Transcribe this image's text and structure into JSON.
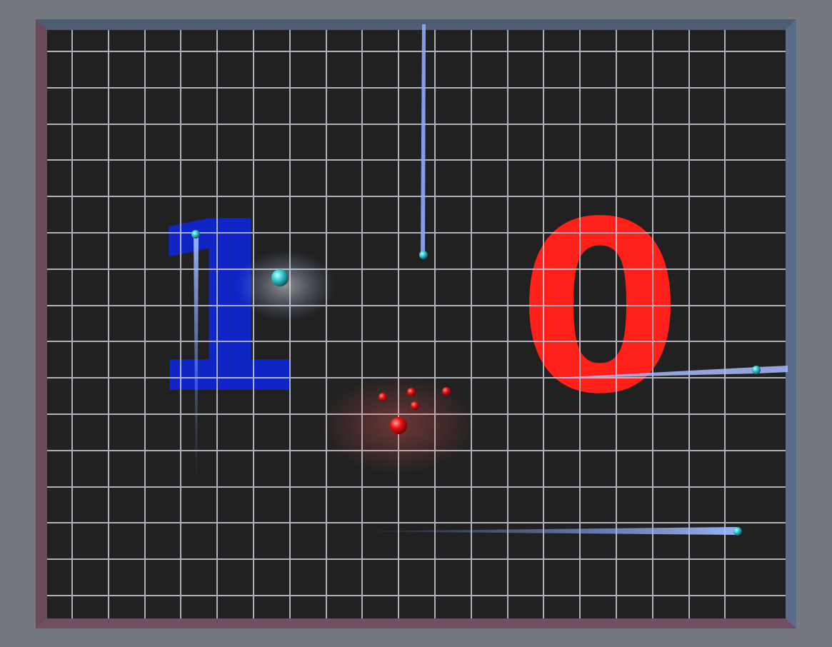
{
  "game": {
    "title": "",
    "score": {
      "blue": 1,
      "red": 0
    }
  },
  "score_display": {
    "blue_value": "1",
    "red_value": "0"
  },
  "colors": {
    "background": "#75787f",
    "frame_top": "#4e5d72",
    "frame_left": "#6a4a5a",
    "frame_right": "#5a6c88",
    "frame_bottom": "#6e5062",
    "field": "#212121",
    "grid": "#c9c9d8",
    "blue_team": "#0f26c4",
    "red_team": "#ff2019",
    "blue_trail": "#7fa0ff",
    "blue_ball": "#35c8cc",
    "red_ball": "#e81010"
  },
  "entities": [
    {
      "name": "blue-player-ball",
      "team": "blue",
      "kind": "player"
    },
    {
      "name": "blue-projectile-1",
      "team": "blue",
      "kind": "projectile"
    },
    {
      "name": "blue-projectile-2",
      "team": "blue",
      "kind": "projectile"
    },
    {
      "name": "blue-projectile-3",
      "team": "blue",
      "kind": "projectile"
    },
    {
      "name": "blue-projectile-4",
      "team": "blue",
      "kind": "projectile"
    },
    {
      "name": "blue-projectile-5",
      "team": "blue",
      "kind": "projectile"
    },
    {
      "name": "red-player-ball",
      "team": "red",
      "kind": "player"
    },
    {
      "name": "red-projectile-1",
      "team": "red",
      "kind": "projectile"
    },
    {
      "name": "red-projectile-2",
      "team": "red",
      "kind": "projectile"
    },
    {
      "name": "red-projectile-3",
      "team": "red",
      "kind": "projectile"
    },
    {
      "name": "red-projectile-4",
      "team": "red",
      "kind": "projectile"
    }
  ]
}
